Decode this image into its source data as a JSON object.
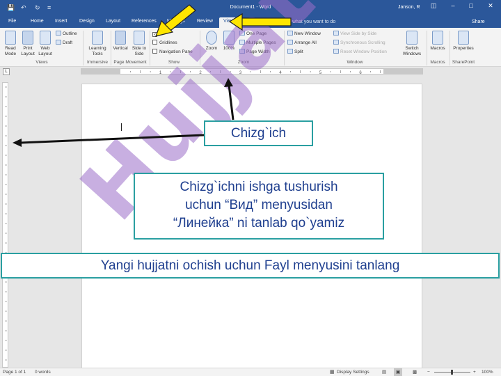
{
  "titlebar": {
    "save_icon": "save-icon",
    "undo_icon": "undo-icon",
    "redo_icon": "redo-icon",
    "customize_icon": "customize-qat-icon",
    "doc_title": "Document1 - Word",
    "user": "Janson, R",
    "window_buttons": [
      "ribbon-display-icon",
      "minimize-icon",
      "maximize-icon",
      "close-icon"
    ]
  },
  "tabs": [
    "File",
    "Home",
    "Insert",
    "Design",
    "Layout",
    "References",
    "Mailings",
    "Review",
    "View"
  ],
  "active_tab": "View",
  "tell_me": "what you want to do",
  "share": "Share",
  "ribbon": {
    "views": {
      "label": "Views",
      "read_mode": "Read Mode",
      "print_layout": "Print Layout",
      "web_layout": "Web Layout",
      "outline": "Outline",
      "draft": "Draft"
    },
    "immersive": {
      "label": "Immersive",
      "learning_tools": "Learning Tools"
    },
    "page_movement": {
      "label": "Page Movement",
      "vertical": "Vertical",
      "side_to_side": "Side to Side"
    },
    "show": {
      "label": "Show",
      "ruler": "R",
      "ruler_checked": true,
      "gridlines": "Gridlines",
      "navigation_pane": "Navigation Pane"
    },
    "zoom": {
      "label": "Zoom",
      "zoom": "Zoom",
      "hundred": "100%",
      "one_page": "One Page",
      "multiple_pages": "Multiple Pages",
      "page_width": "Page Width"
    },
    "window": {
      "label": "Window",
      "new_window": "New Window",
      "arrange_all": "Arrange All",
      "split": "Split",
      "view_side_by_side": "View Side by Side",
      "sync_scrolling": "Synchronous Scrolling",
      "reset_window": "Reset Window Position",
      "switch_windows": "Switch Windows"
    },
    "macros": {
      "label": "Macros",
      "macros": "Macros"
    },
    "sharepoint": {
      "label": "SharePoint",
      "properties": "Properties"
    }
  },
  "ruler_numbers": [
    "1",
    "2",
    "3",
    "4",
    "5",
    "6"
  ],
  "statusbar": {
    "page": "Page 1 of 1",
    "words": "0 words",
    "display_settings": "Display Settings",
    "zoom_minus": "−",
    "zoom_plus": "+",
    "zoom_level": "100%"
  },
  "callouts": {
    "ruler": "Chizg`ich",
    "instruction_lines": [
      "Chizg`ichni ishga tushurish",
      "uchun “Вид” menyusidan",
      "“Линейка” ni tanlab qo`yamiz"
    ],
    "file_menu": "Yangi hujjatni ochish uchun Fayl menyusini tanlang"
  },
  "watermark": "Hujjat24",
  "colors": {
    "word_blue": "#2b579a",
    "callout_border": "#2a9fa1",
    "callout_text": "#1f3f8f",
    "arrow_yellow": "#ffe600",
    "watermark": "#9b6ec8"
  }
}
